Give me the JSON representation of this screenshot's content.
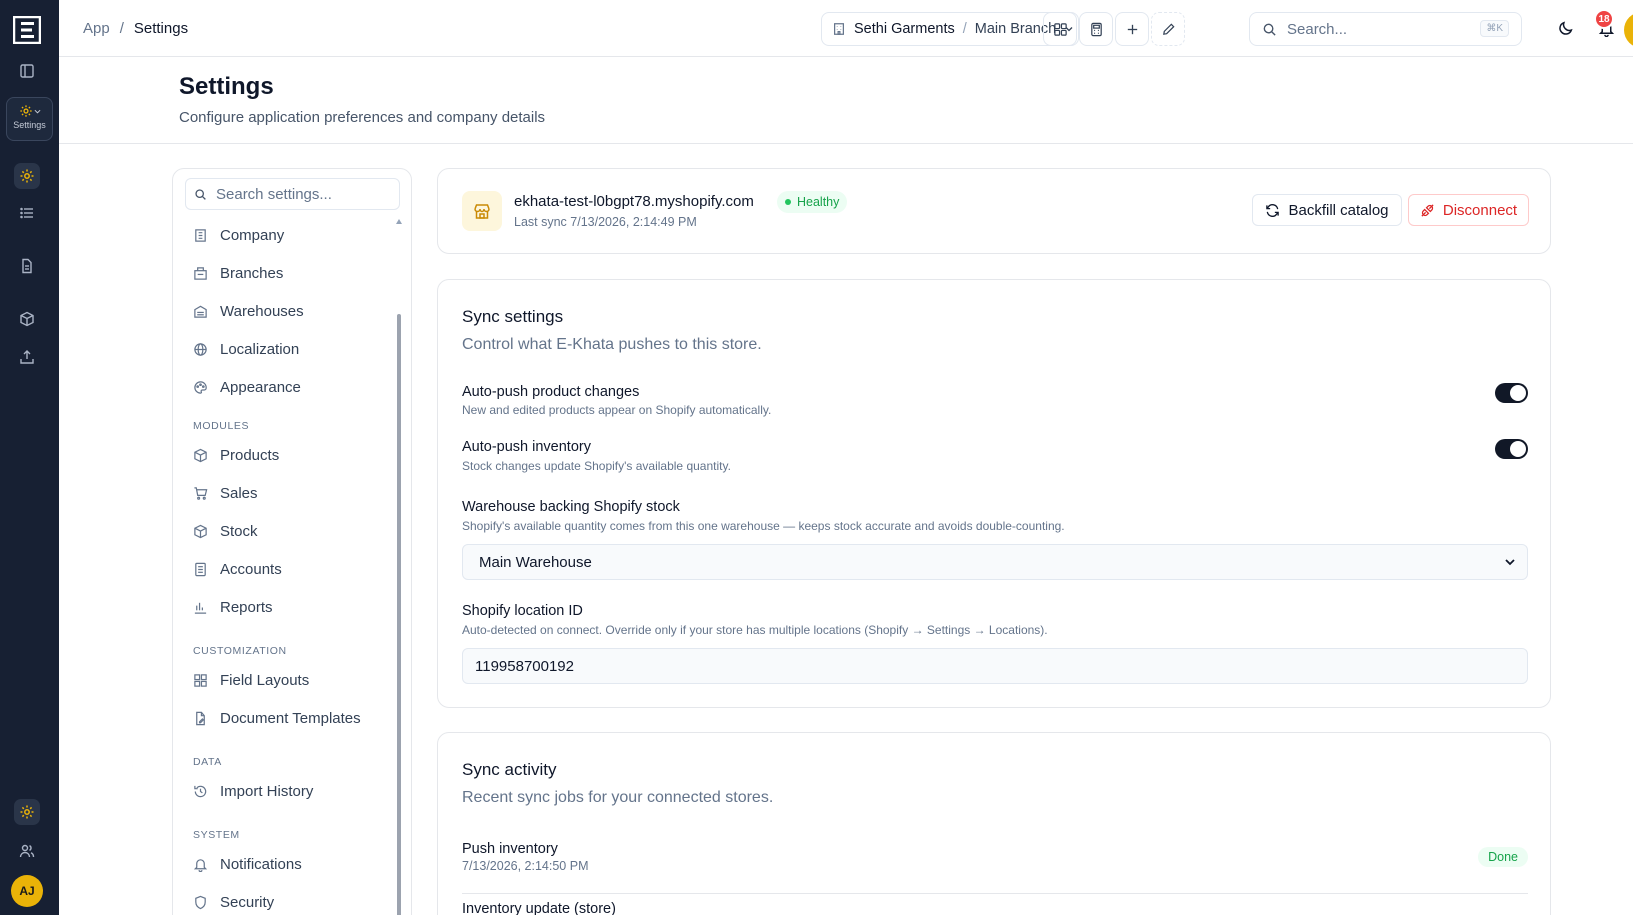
{
  "rail": {
    "settings_label": "Settings",
    "avatar": "AJ"
  },
  "topbar": {
    "crumb_root": "App",
    "crumb_sep": "/",
    "crumb_current": "Settings",
    "company": "Sethi Garments",
    "branch_sep": "/",
    "branch": "Main Branch",
    "search_placeholder": "Search...",
    "search_kbd": "⌘K",
    "notifications_count": "18",
    "avatar": "AJ"
  },
  "page": {
    "title": "Settings",
    "subtitle": "Configure application preferences and company details"
  },
  "nav": {
    "search_placeholder": "Search settings...",
    "items_general": [
      {
        "label": "Company",
        "icon": "building-icon"
      },
      {
        "label": "Branches",
        "icon": "branches-icon"
      },
      {
        "label": "Warehouses",
        "icon": "warehouse-icon"
      },
      {
        "label": "Localization",
        "icon": "globe-icon"
      },
      {
        "label": "Appearance",
        "icon": "palette-icon"
      }
    ],
    "section_modules": "MODULES",
    "items_modules": [
      {
        "label": "Products",
        "icon": "package-icon"
      },
      {
        "label": "Sales",
        "icon": "cart-icon"
      },
      {
        "label": "Stock",
        "icon": "box-icon"
      },
      {
        "label": "Accounts",
        "icon": "ledger-icon"
      },
      {
        "label": "Reports",
        "icon": "bar-chart-icon"
      }
    ],
    "section_customization": "CUSTOMIZATION",
    "items_customization": [
      {
        "label": "Field Layouts",
        "icon": "grid-icon"
      },
      {
        "label": "Document Templates",
        "icon": "file-edit-icon"
      }
    ],
    "section_data": "DATA",
    "items_data": [
      {
        "label": "Import History",
        "icon": "history-icon"
      }
    ],
    "section_system": "SYSTEM",
    "items_system": [
      {
        "label": "Notifications",
        "icon": "bell-icon"
      },
      {
        "label": "Security",
        "icon": "shield-icon"
      }
    ]
  },
  "store": {
    "domain": "ekhata-test-l0bgpt78.myshopify.com",
    "status": "Healthy",
    "last_sync": "Last sync 7/13/2026, 2:14:49 PM",
    "backfill_label": "Backfill catalog",
    "disconnect_label": "Disconnect"
  },
  "sync_settings": {
    "title": "Sync settings",
    "subtitle": "Control what E-Khata pushes to this store.",
    "auto_push_products_label": "Auto-push product changes",
    "auto_push_products_help": "New and edited products appear on Shopify automatically.",
    "auto_push_products_on": true,
    "auto_push_inventory_label": "Auto-push inventory",
    "auto_push_inventory_help": "Stock changes update Shopify's available quantity.",
    "auto_push_inventory_on": true,
    "warehouse_label": "Warehouse backing Shopify stock",
    "warehouse_help": "Shopify's available quantity comes from this one warehouse — keeps stock accurate and avoids double-counting.",
    "warehouse_value": "Main Warehouse",
    "location_label": "Shopify location ID",
    "location_help": "Auto-detected on connect. Override only if your store has multiple locations (Shopify → Settings → Locations).",
    "location_value": "119958700192"
  },
  "activity": {
    "title": "Sync activity",
    "subtitle": "Recent sync jobs for your connected stores.",
    "jobs": [
      {
        "title": "Push inventory",
        "time": "7/13/2026, 2:14:50 PM",
        "status": "Done"
      },
      {
        "title": "Inventory update (store)",
        "time": "",
        "status": ""
      }
    ]
  },
  "colors": {
    "rail_bg": "#172033",
    "accent": "#eab308",
    "success": "#16a34a",
    "danger": "#dc2626"
  }
}
